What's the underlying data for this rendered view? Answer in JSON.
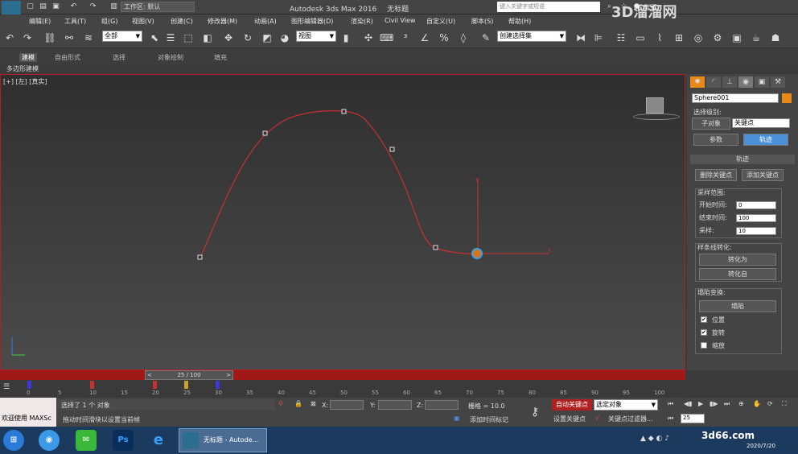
{
  "window": {
    "app_title": "Autodesk 3ds Max 2016",
    "doc_title": "无标题",
    "workspace_label": "工作区: 默认",
    "search_placeholder": "键入关键字或短语",
    "login_label": "登录",
    "logo_label": "MAX"
  },
  "watermark": {
    "text": "3D溜溜网",
    "subtext": "3d66.com",
    "date": "2020/7/20"
  },
  "menu": [
    "编辑(E)",
    "工具(T)",
    "组(G)",
    "视图(V)",
    "创建(C)",
    "修改器(M)",
    "动画(A)",
    "图形编辑器(D)",
    "渲染(R)",
    "Civil View",
    "自定义(U)",
    "脚本(S)",
    "帮助(H)"
  ],
  "toolbar": {
    "selection_filter": "全部",
    "reference_coord": "视图",
    "named_selection": "创建选择集"
  },
  "ribbon": {
    "tabs": [
      "建模",
      "自由形式",
      "选择",
      "对象绘制",
      "填充"
    ],
    "sub_label": "多边形建模"
  },
  "viewport": {
    "label": "[+] [左] [真实]"
  },
  "command_panel": {
    "object_name": "Sphere001",
    "object_color": "#e88a1a",
    "selection_level_label": "选择级别:",
    "sub_object_label": "子对象",
    "sub_object_value": "关键点",
    "params_button": "参数",
    "trajectory_button": "轨迹",
    "rollout_title": "轨迹",
    "delete_key_button": "删除关键点",
    "add_key_button": "添加关键点",
    "sample_range_title": "采样范围:",
    "start_time_label": "开始时间:",
    "start_time_value": "0",
    "end_time_label": "结束时间:",
    "end_time_value": "100",
    "samples_label": "采样:",
    "samples_value": "10",
    "spline_convert_title": "样条线转化:",
    "convert_to_button": "转化为",
    "convert_from_button": "转化自",
    "collapse_title": "塌陷变换:",
    "collapse_button": "塌陷",
    "position_label": "位置",
    "position_checked": "✔",
    "rotation_label": "旋转",
    "rotation_checked": "✔",
    "scale_label": "缩放"
  },
  "timeline": {
    "frame_display": "25 / 100",
    "current_frame": 25,
    "total_frames": 100,
    "ticks": [
      "0",
      "5",
      "10",
      "15",
      "20",
      "25",
      "30",
      "35",
      "40",
      "45",
      "50",
      "55",
      "60",
      "65",
      "70",
      "75",
      "80",
      "85",
      "90",
      "95",
      "100"
    ]
  },
  "status": {
    "maxscript_label": "欢迎使用 MAXSc",
    "selection_status": "选择了 1 个 对象",
    "prompt": "拖动时间滑块以设置当前帧",
    "x_label": "X:",
    "y_label": "Y:",
    "z_label": "Z:",
    "grid": "栅格 = 10.0",
    "add_time_tag": "添加时间标记",
    "auto_key": "自动关键点",
    "set_key": "设置关键点",
    "key_mode_dropdown": "选定对象",
    "key_filters": "关键点过滤器...",
    "frame_field": "25"
  },
  "taskbar": {
    "active_task": "无标题 - Autode..."
  }
}
